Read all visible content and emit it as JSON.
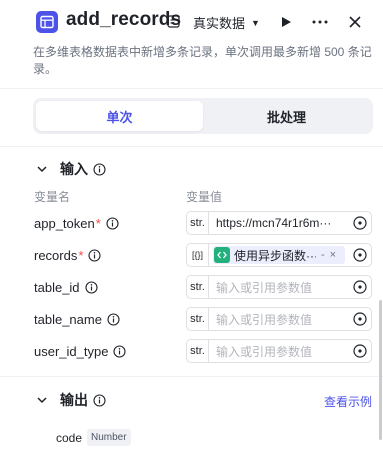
{
  "header": {
    "title": "add_records",
    "env_label": "真实数据",
    "icons": {
      "app": "table-grid-icon",
      "run": "play-icon",
      "more": "more-dots-icon",
      "close": "close-icon"
    }
  },
  "description": "在多维表格数据表中新增多条记录，单次调用最多新增 500 条记录。",
  "mode_tabs": [
    {
      "label": "单次",
      "active": true
    },
    {
      "label": "批处理",
      "active": false
    }
  ],
  "input_section": {
    "title": "输入",
    "col_name": "变量名",
    "col_value": "变量值",
    "rows": [
      {
        "name": "app_token",
        "required": true,
        "type": "str.",
        "value": "https://mcn74r1r6m···",
        "placeholder": ""
      },
      {
        "name": "records",
        "required": true,
        "type": "[{}]",
        "chip_text": "使用异步函数···",
        "chip_dash": "-",
        "chip_close": "×"
      },
      {
        "name": "table_id",
        "required": false,
        "type": "str.",
        "value": "",
        "placeholder": "输入或引用参数值"
      },
      {
        "name": "table_name",
        "required": false,
        "type": "str.",
        "value": "",
        "placeholder": "输入或引用参数值"
      },
      {
        "name": "user_id_type",
        "required": false,
        "type": "str.",
        "value": "",
        "placeholder": "输入或引用参数值"
      }
    ]
  },
  "output_section": {
    "title": "输出",
    "example_link": "查看示例",
    "fields": [
      {
        "name": "code",
        "type": "Number"
      }
    ]
  },
  "colors": {
    "accent": "#4d53e8",
    "required": "#f54a45",
    "chip_icon": "#22b07d"
  }
}
